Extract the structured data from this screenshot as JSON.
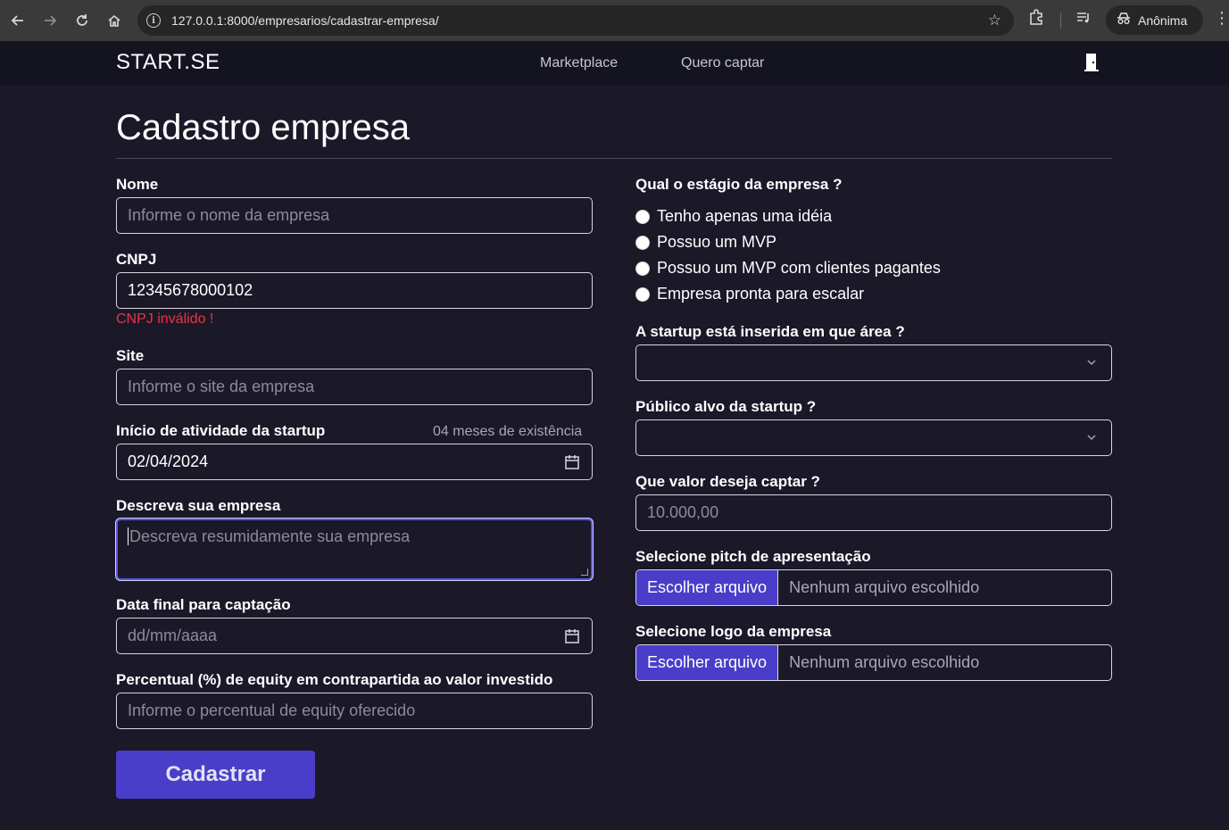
{
  "browser": {
    "url": "127.0.0.1:8000/empresarios/cadastrar-empresa/",
    "profile_label": "Anônima"
  },
  "navbar": {
    "brand": "START.SE",
    "links": [
      "Marketplace",
      "Quero captar"
    ]
  },
  "page": {
    "title": "Cadastro empresa"
  },
  "form_left": {
    "nome_label": "Nome",
    "nome_placeholder": "Informe o nome da empresa",
    "cnpj_label": "CNPJ",
    "cnpj_value": "12345678000102",
    "cnpj_error": "CNPJ inválido !",
    "site_label": "Site",
    "site_placeholder": "Informe o site da empresa",
    "inicio_label": "Início de atividade da startup",
    "inicio_hint": "04 meses de existência",
    "inicio_value": "02/04/2024",
    "descricao_label": "Descreva sua empresa",
    "descricao_placeholder": "Descreva resumidamente sua empresa",
    "data_final_label": "Data final para captação",
    "data_final_placeholder": "dd/mm/aaaa",
    "equity_label": "Percentual (%) de equity em contrapartida ao valor investido",
    "equity_placeholder": "Informe o percentual de equity oferecido",
    "submit_label": "Cadastrar"
  },
  "form_right": {
    "estagio_label": "Qual o estágio da empresa ?",
    "estagio_options": [
      "Tenho apenas uma idéia",
      "Possuo um MVP",
      "Possuo um MVP com clientes pagantes",
      "Empresa pronta para escalar"
    ],
    "area_label": "A startup está inserida em que área ?",
    "publico_label": "Público alvo da startup ?",
    "valor_label": "Que valor deseja captar ?",
    "valor_placeholder": "10.000,00",
    "pitch_label": "Selecione pitch de apresentação",
    "logo_label": "Selecione logo da empresa",
    "file_button_label": "Escolher arquivo",
    "file_none_label": "Nenhum arquivo escolhido"
  },
  "colors": {
    "background": "#1b1828",
    "navbar": "#141320",
    "accent": "#4a3dc9",
    "error": "#ea3447"
  },
  "icons": [
    "back-icon",
    "forward-icon",
    "reload-icon",
    "home-icon",
    "site-info-icon",
    "star-icon",
    "extensions-icon",
    "media-icon",
    "incognito-icon",
    "menu-icon",
    "logout-door-icon",
    "calendar-icon",
    "chevron-down-icon"
  ]
}
